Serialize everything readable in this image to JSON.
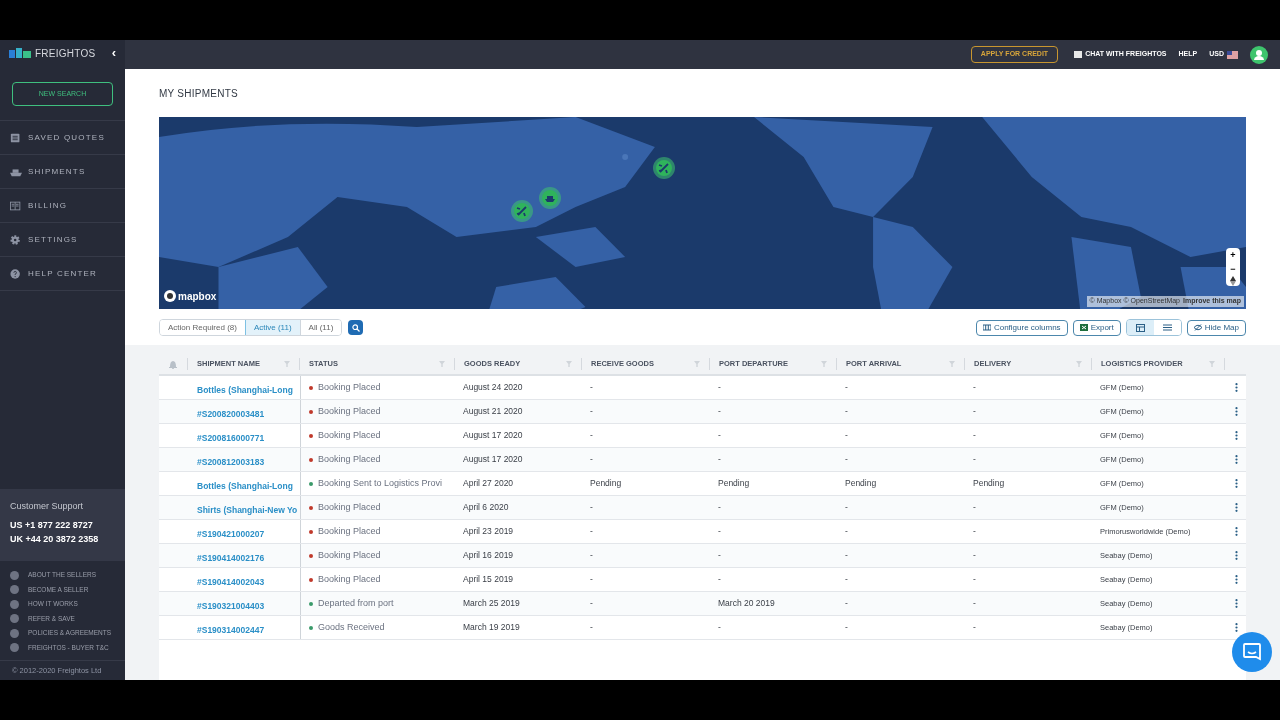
{
  "sidebar": {
    "brand": "FREIGHTOS",
    "collapse": "‹",
    "new_search": "NEW SEARCH",
    "items": [
      {
        "label": "SAVED QUOTES",
        "kind": "quotes",
        "selected": false
      },
      {
        "label": "SHIPMENTS",
        "kind": "ship",
        "selected": false
      },
      {
        "label": "BILLING",
        "kind": "billing",
        "selected": false
      },
      {
        "label": "SETTINGS",
        "kind": "gear",
        "selected": false
      },
      {
        "label": "HELP CENTER",
        "kind": "help",
        "selected": false
      }
    ],
    "support": {
      "title": "Customer Support",
      "phones": [
        "US +1 877 222 8727",
        "UK +44 20 3872 2358"
      ]
    },
    "links": [
      "ABOUT THE SELLERS",
      "BECOME A SELLER",
      "HOW IT WORKS",
      "REFER & SAVE",
      "POLICIES & AGREEMENTS",
      "FREIGHTOS - BUYER T&C"
    ],
    "copyright": "© 2012-2020 Freightos Ltd"
  },
  "topbar": {
    "credit": "APPLY FOR CREDIT",
    "chat": "CHAT WITH FREIGHTOS",
    "help": "HELP",
    "currency": "USD"
  },
  "page_title": "MY SHIPMENTS",
  "map": {
    "logo": "mapbox",
    "attribution": "© Mapbox © OpenStreetMap",
    "improve": "Improve this map",
    "zoom_in": "+",
    "zoom_out": "−"
  },
  "filters": [
    {
      "label": "Action Required (8)",
      "selected": false
    },
    {
      "label": "Active (11)",
      "selected": true
    },
    {
      "label": "All (11)",
      "selected": false
    }
  ],
  "actions": {
    "configure": "Configure columns",
    "export": "Export",
    "views": [
      {
        "kind": "grid",
        "selected": true
      },
      {
        "kind": "list",
        "selected": false
      }
    ],
    "hide_map": "Hide Map"
  },
  "table": {
    "columns": [
      "SHIPMENT NAME",
      "STATUS",
      "GOODS READY",
      "RECEIVE GOODS",
      "PORT DEPARTURE",
      "PORT ARRIVAL",
      "DELIVERY",
      "LOGISTICS PROVIDER"
    ],
    "rows": [
      {
        "color": "#c0392b",
        "cells": [
          "Bottles (Shanghai-Long",
          "Booking Placed",
          "August 24 2020",
          "-",
          "-",
          "-",
          "-",
          "GFM (Demo)"
        ]
      },
      {
        "color": "#c0392b",
        "cells": [
          "#S200820003481",
          "Booking Placed",
          "August 21 2020",
          "-",
          "-",
          "-",
          "-",
          "GFM (Demo)"
        ]
      },
      {
        "color": "#c0392b",
        "cells": [
          "#S200816000771",
          "Booking Placed",
          "August 17 2020",
          "-",
          "-",
          "-",
          "-",
          "GFM (Demo)"
        ]
      },
      {
        "color": "#c0392b",
        "cells": [
          "#S200812003183",
          "Booking Placed",
          "August 17 2020",
          "-",
          "-",
          "-",
          "-",
          "GFM (Demo)"
        ]
      },
      {
        "color": "#3a9a6a",
        "cells": [
          "Bottles (Shanghai-Long",
          "Booking Sent to Logistics Provi",
          "April 27 2020",
          "Pending",
          "Pending",
          "Pending",
          "Pending",
          "GFM (Demo)"
        ]
      },
      {
        "color": "#c0392b",
        "cells": [
          "Shirts (Shanghai-New Yo",
          "Booking Placed",
          "April 6 2020",
          "-",
          "-",
          "-",
          "-",
          "GFM (Demo)"
        ]
      },
      {
        "color": "#c0392b",
        "cells": [
          "#S190421000207",
          "Booking Placed",
          "April 23 2019",
          "-",
          "-",
          "-",
          "-",
          "Primorusworldwide (Demo)"
        ]
      },
      {
        "color": "#c0392b",
        "cells": [
          "#S190414002176",
          "Booking Placed",
          "April 16 2019",
          "-",
          "-",
          "-",
          "-",
          "Seabay (Demo)"
        ]
      },
      {
        "color": "#c0392b",
        "cells": [
          "#S190414002043",
          "Booking Placed",
          "April 15 2019",
          "-",
          "-",
          "-",
          "-",
          "Seabay (Demo)"
        ]
      },
      {
        "color": "#3a9a6a",
        "cells": [
          "#S190321004403",
          "Departed from port",
          "March 25 2019",
          "-",
          "March 20 2019",
          "-",
          "-",
          "Seabay (Demo)"
        ]
      },
      {
        "color": "#3a9a6a",
        "cells": [
          "#S190314002447",
          "Goods Received",
          "March 19 2019",
          "-",
          "-",
          "-",
          "-",
          "Seabay (Demo)"
        ]
      }
    ]
  }
}
